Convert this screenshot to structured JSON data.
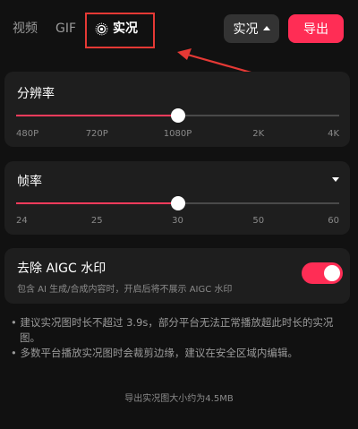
{
  "tabs": {
    "video": "视频",
    "gif": "GIF",
    "live": "实况"
  },
  "header": {
    "mode_label": "实况",
    "export_label": "导出"
  },
  "resolution": {
    "title": "分辨率",
    "ticks": [
      "480P",
      "720P",
      "1080P",
      "2K",
      "4K"
    ],
    "selected_index": 2
  },
  "framerate": {
    "title": "帧率",
    "ticks": [
      "24",
      "25",
      "30",
      "50",
      "60"
    ],
    "selected_index": 2
  },
  "aigc": {
    "title": "去除 AIGC 水印",
    "subtitle": "包含 AI 生成/合成内容时，开启后将不展示 AIGC 水印",
    "enabled": true
  },
  "notes": [
    "• 建议实况图时长不超过 3.9s，部分平台无法正常播放超此时长的实况图。",
    "• 多数平台播放实况图时会裁剪边缘，建议在安全区域内编辑。"
  ],
  "footer": {
    "size_text": "导出实况图大小约为4.5MB"
  },
  "colors": {
    "accent": "#ff2d55",
    "annotation": "#e53935",
    "card": "#1e1e1e",
    "background": "#111111"
  }
}
